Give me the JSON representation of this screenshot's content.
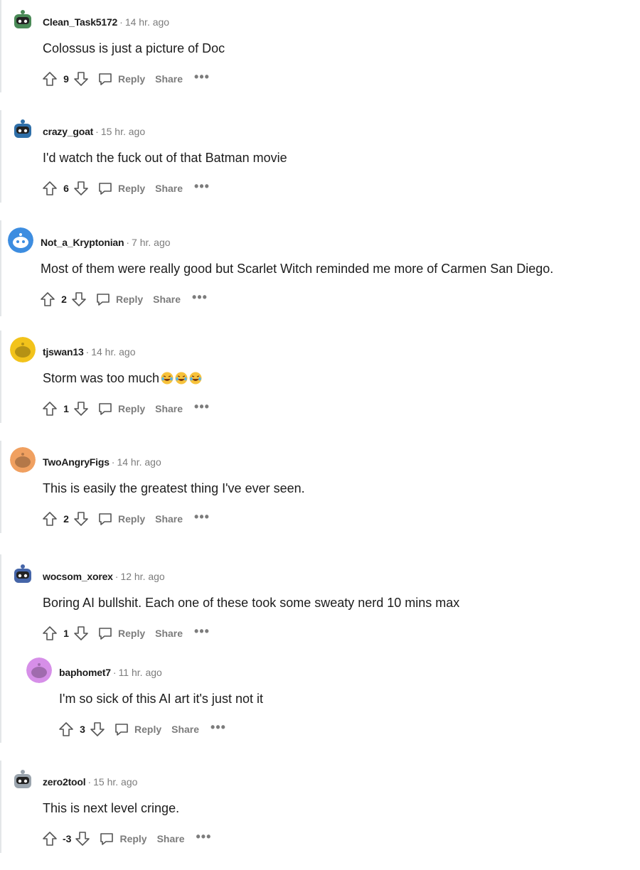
{
  "meta_separator": "·",
  "action_labels": {
    "reply": "Reply",
    "share": "Share",
    "more": "•••"
  },
  "comments": [
    {
      "username": "Clean_Task5172",
      "time": "14 hr. ago",
      "text": "Colossus is just a picture of Doc",
      "score": "9",
      "avatar_icon": "snoo-green-avatar",
      "avatar_color": "#4a8a57"
    },
    {
      "username": "crazy_goat",
      "time": "15 hr. ago",
      "text": "I'd watch the fuck out of that Batman movie",
      "score": "6",
      "avatar_icon": "snoo-astronaut-avatar",
      "avatar_color": "#2f6fa8"
    },
    {
      "username": "Not_a_Kryptonian",
      "time": "7 hr. ago",
      "text": "Most of them were really good but Scarlet Witch reminded me more of Carmen San Diego.",
      "score": "2",
      "avatar_icon": "snoo-blue-avatar",
      "avatar_color": "#3d8de0"
    },
    {
      "username": "tjswan13",
      "time": "14 hr. ago",
      "text": "Storm was too much",
      "score": "1",
      "avatar_icon": "snoo-yellow-avatar",
      "avatar_color": "#f2c31b",
      "emoji_icon": "rofl-emoji"
    },
    {
      "username": "TwoAngryFigs",
      "time": "14 hr. ago",
      "text": "This is easily the greatest thing I've ever seen.",
      "score": "2",
      "avatar_icon": "snoo-orange-avatar",
      "avatar_color": "#f0a060"
    },
    {
      "username": "wocsom_xorex",
      "time": "12 hr. ago",
      "text": "Boring AI bullshit. Each one of these took some sweaty nerd 10 mins max",
      "score": "1",
      "avatar_icon": "snoo-robot-avatar",
      "avatar_color": "#4565a8"
    },
    {
      "username": "baphomet7",
      "time": "11 hr. ago",
      "text": "I'm so sick of this AI art it's just not it",
      "score": "3",
      "avatar_icon": "snoo-purple-avatar",
      "avatar_color": "#d68fe8"
    },
    {
      "username": "zero2tool",
      "time": "15 hr. ago",
      "text": "This is next level cringe.",
      "score": "-3",
      "avatar_icon": "snoo-grey-avatar",
      "avatar_color": "#9aa4ad"
    }
  ]
}
